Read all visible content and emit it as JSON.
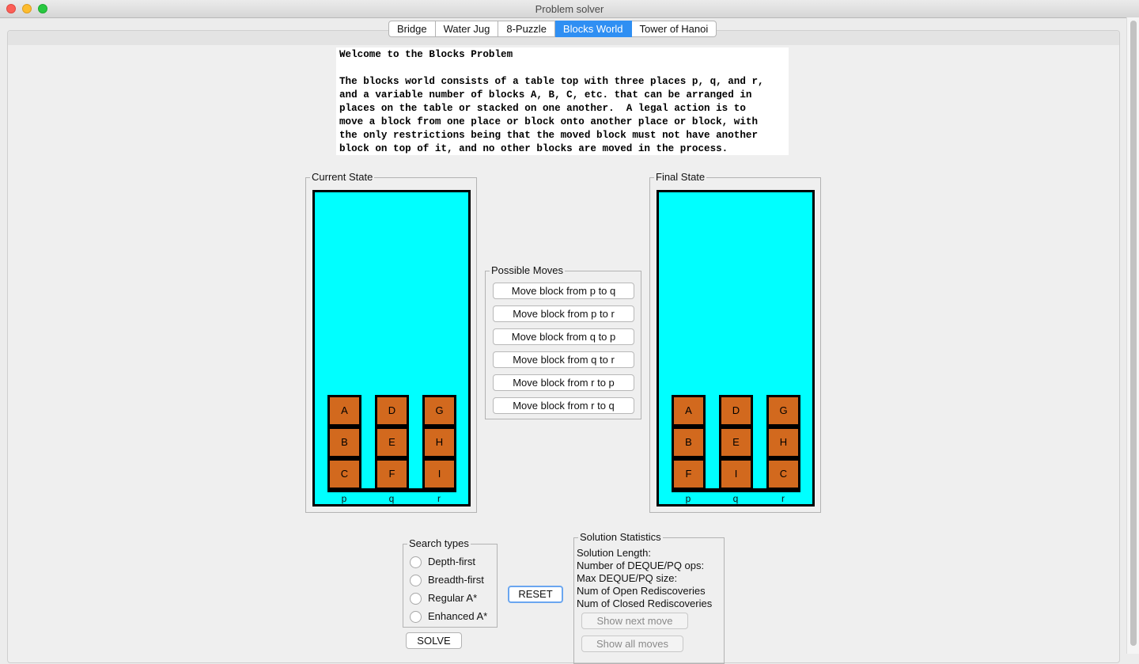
{
  "window": {
    "title": "Problem solver"
  },
  "tabs": [
    {
      "label": "Bridge"
    },
    {
      "label": "Water Jug"
    },
    {
      "label": "8-Puzzle"
    },
    {
      "label": "Blocks World",
      "active": true
    },
    {
      "label": "Tower of Hanoi"
    }
  ],
  "description": "Welcome to the Blocks Problem\n\nThe blocks world consists of a table top with three places p, q, and r,\nand a variable number of blocks A, B, C, etc. that can be arranged in\nplaces on the table or stacked on one another.  A legal action is to\nmove a block from one place or block onto another place or block, with\nthe only restrictions being that the moved block must not have another\nblock on top of it, and no other blocks are moved in the process.",
  "current_state": {
    "label": "Current State",
    "stacks": [
      [
        "A",
        "B",
        "C"
      ],
      [
        "D",
        "E",
        "F"
      ],
      [
        "G",
        "H",
        "I"
      ]
    ],
    "places": [
      "p",
      "q",
      "r"
    ]
  },
  "final_state": {
    "label": "Final State",
    "stacks": [
      [
        "A",
        "B",
        "F"
      ],
      [
        "D",
        "E",
        "I"
      ],
      [
        "G",
        "H",
        "C"
      ]
    ],
    "places": [
      "p",
      "q",
      "r"
    ]
  },
  "possible_moves": {
    "label": "Possible Moves",
    "moves": [
      "Move block from p to q",
      "Move block from p to r",
      "Move block from q to p",
      "Move block from q to r",
      "Move block from r to p",
      "Move block from r to q"
    ]
  },
  "search_types": {
    "label": "Search types",
    "options": [
      "Depth-first",
      "Breadth-first",
      "Regular A*",
      "Enhanced A*"
    ]
  },
  "buttons": {
    "reset": "RESET",
    "solve": "SOLVE",
    "show_next": "Show next move",
    "show_all": "Show all moves"
  },
  "solution_statistics": {
    "label": "Solution Statistics",
    "lines": [
      "Solution Length:",
      "Number of DEQUE/PQ ops:",
      "Max DEQUE/PQ size:",
      "Num of Open Rediscoveries",
      "Num of Closed Rediscoveries"
    ]
  },
  "colors": {
    "board": "#00ffff",
    "block": "#d2691e",
    "active_tab": "#2f8ff3"
  }
}
